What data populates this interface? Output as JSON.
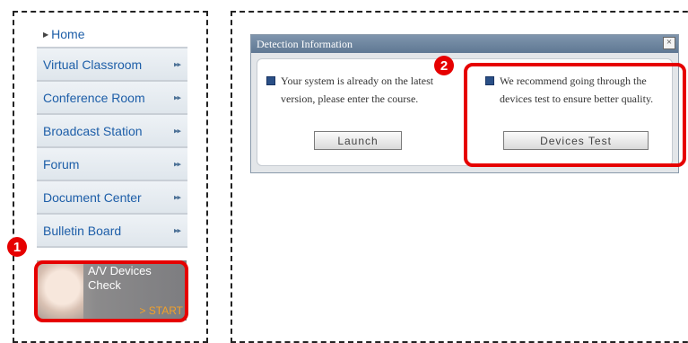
{
  "sidebar": {
    "items": [
      {
        "label": "Home"
      },
      {
        "label": "Virtual Classroom"
      },
      {
        "label": "Conference Room"
      },
      {
        "label": "Broadcast Station"
      },
      {
        "label": "Forum"
      },
      {
        "label": "Document Center"
      },
      {
        "label": "Bulletin Board"
      }
    ],
    "arrow_glyph": "▸▸"
  },
  "av_banner": {
    "title_line1": "A/V Devices",
    "title_line2": "Check",
    "start": "> START"
  },
  "callouts": {
    "one": "1",
    "two": "2"
  },
  "dialog": {
    "title": "Detection Information",
    "close": "×",
    "left_message": "Your system is already on the latest version, please enter the course.",
    "right_message": "We recommend going through the devices test to ensure better quality.",
    "launch_label": "Launch",
    "devices_test_label": "Devices Test"
  },
  "colors": {
    "callout": "#e60000",
    "link": "#1d5ea8",
    "title_bar": "#6f86a0"
  }
}
